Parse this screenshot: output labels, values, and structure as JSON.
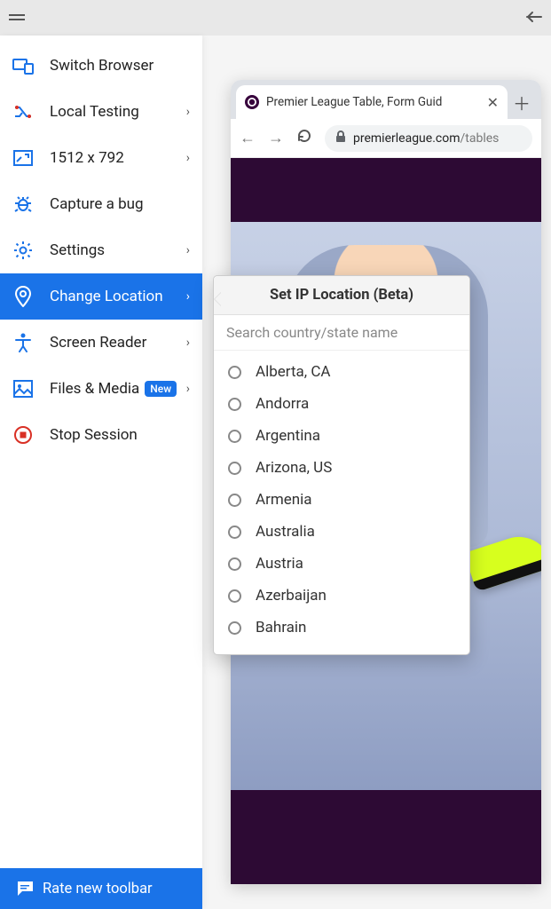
{
  "topbar": {},
  "sidebar": {
    "items": [
      {
        "label": "Switch Browser",
        "chevron": false
      },
      {
        "label": "Local Testing",
        "chevron": true
      },
      {
        "label": "1512 x 792",
        "chevron": true
      },
      {
        "label": "Capture a bug",
        "chevron": false
      },
      {
        "label": "Settings",
        "chevron": true
      },
      {
        "label": "Change Location",
        "chevron": true
      },
      {
        "label": "Screen Reader",
        "chevron": true
      },
      {
        "label": "Files & Media",
        "chevron": true,
        "badge": "New"
      },
      {
        "label": "Stop Session",
        "chevron": false
      }
    ]
  },
  "bottom": {
    "label": "Rate new toolbar"
  },
  "browser": {
    "tab_title": "Premier League Table, Form Guid",
    "url_domain": "premierleague.com",
    "url_path": "/tables"
  },
  "popover": {
    "title": "Set IP Location (Beta)",
    "placeholder": "Search country/state name",
    "locations": [
      "Alberta, CA",
      "Andorra",
      "Argentina",
      "Arizona, US",
      "Armenia",
      "Australia",
      "Austria",
      "Azerbaijan",
      "Bahrain"
    ]
  }
}
